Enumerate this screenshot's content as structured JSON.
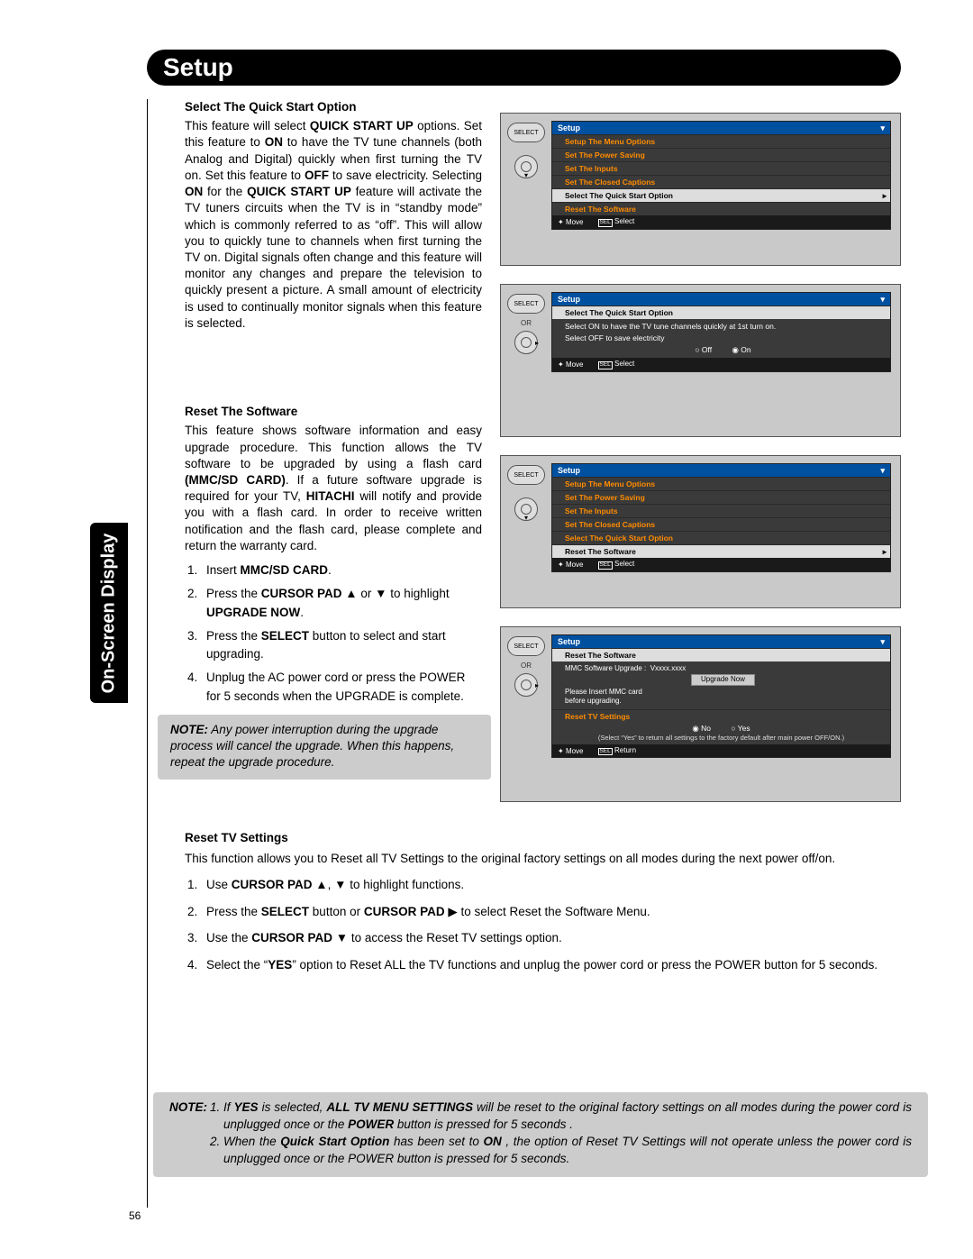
{
  "page_number": "56",
  "side_tab": "On-Screen Display",
  "header": "Setup",
  "sec1": {
    "title": "Select The Quick Start Option",
    "html": "This feature will select <b>QUICK START UP</b> options. Set this feature to <b>ON</b> to have the TV tune channels (both Analog and Digital) quickly when first turning the TV on. Set this feature to <b>OFF</b> to save electricity. Selecting <b>ON</b> for the <b>QUICK START UP</b> feature will activate the TV tuners circuits when the TV is in “standby mode” which is commonly referred to as “off”. This will allow you to quickly tune to channels when first turning the TV on. Digital signals often change and this feature will monitor any changes and prepare the television to quickly present a picture. A small amount of electricity is used to continually monitor signals when this feature is selected."
  },
  "sec2": {
    "title": "Reset The Software",
    "html": "This feature shows software information and easy upgrade procedure. This function allows the TV software to be upgraded by using a flash card <b>(MMC/SD CARD)</b>. If a future software upgrade is required for your TV, <b>HITACHI</b> will notify and provide you with a flash card. In order to receive written notification and the flash card, please complete and return the warranty card.",
    "steps": [
      "Insert <b>MMC/SD CARD</b>.",
      "Press the <b>CURSOR PAD</b> ▲ or ▼ to highlight <b>UPGRADE NOW</b>.",
      "Press the <b>SELECT</b> button to select and start upgrading.",
      "Unplug the AC power cord or press the POWER for 5 seconds when the UPGRADE is complete."
    ],
    "note": "Any power interruption during the upgrade process will cancel the upgrade. When this happens, repeat the upgrade procedure."
  },
  "sec3": {
    "title": "Reset TV Settings",
    "intro": "This function allows you to Reset all TV Settings to the original factory settings on all modes during the next power off/on.",
    "steps": [
      "Use <b>CURSOR PAD</b> ▲, ▼ to highlight functions.",
      "Press the <b>SELECT</b> button or <b>CURSOR PAD</b> ▶ to select Reset the Software Menu.",
      "Use the <b>CURSOR PAD</b> ▼ to access the Reset TV settings option.",
      "Select the “<b>YES</b>” option to Reset ALL the TV functions and unplug the power cord or press the POWER button for 5 seconds."
    ]
  },
  "note_wide": [
    "If <b>YES</b> is selected, <b>ALL TV MENU SETTINGS</b> will be reset to the original factory settings on all modes during the power cord is unplugged once or the <b>POWER</b> button is pressed for 5 seconds .",
    "When the <b>Quick Start Option</b> has been set to <b>ON</b> , the option of Reset TV Settings will not operate unless the power cord is unplugged once or the POWER button is pressed for 5 seconds."
  ],
  "labels": {
    "select_btn": "SELECT",
    "or": "OR",
    "note": "NOTE:",
    "move": "Move",
    "select_hint": "Select",
    "return_hint": "Return"
  },
  "menu_common": {
    "title": "Setup",
    "items": [
      "Setup The Menu Options",
      "Set The Power Saving",
      "Set The Inputs",
      "Set The Closed Captions",
      "Select The Quick Start Option",
      "Reset The Software"
    ]
  },
  "screen2": {
    "row": "Select The Quick Start Option",
    "info1": "Select ON to have the TV tune channels quickly at 1st turn on.",
    "info2": "Select OFF to save electricity",
    "off": "Off",
    "on": "On"
  },
  "screen4": {
    "row": "Reset The Software",
    "upgrade_label": "MMC Software Upgrade :",
    "version": "Vxxxx.xxxx",
    "upgrade_btn": "Upgrade Now",
    "please1": "Please Insert MMC card",
    "please2": "before upgrading.",
    "reset_row": "Reset TV Settings",
    "no": "No",
    "yes": "Yes",
    "note": "(Select “Yes” to return all settings\nto the factory default after main power OFF/ON.)"
  }
}
